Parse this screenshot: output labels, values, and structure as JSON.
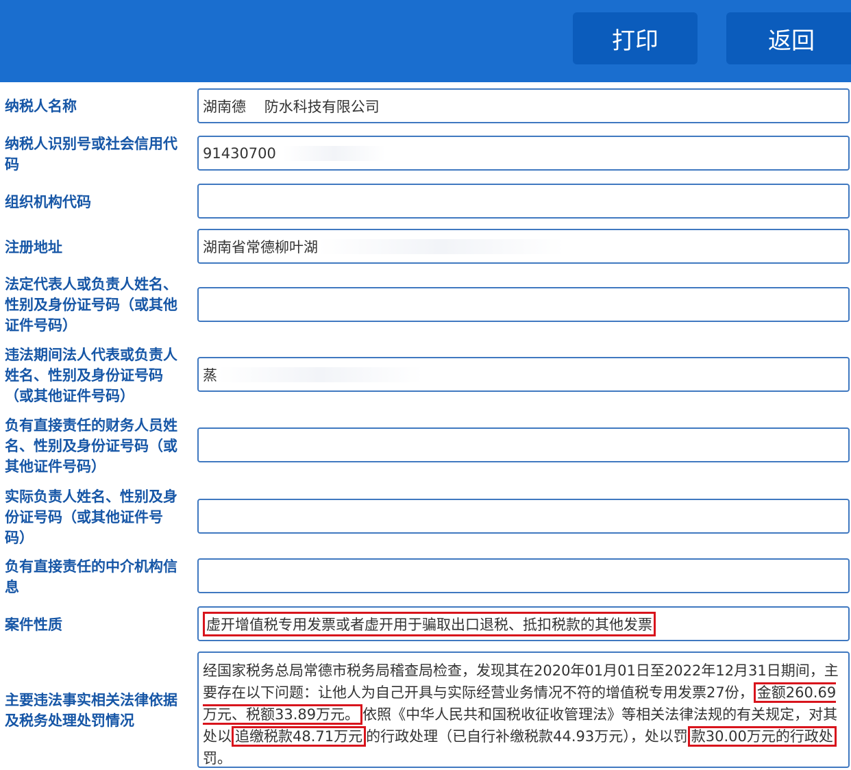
{
  "header": {
    "print_label": "打印",
    "back_label": "返回"
  },
  "fields": {
    "taxpayer_name": {
      "label": "纳税人名称",
      "value": "湖南德    防水科技有限公司"
    },
    "taxpayer_id": {
      "label": "纳税人识别号或社会信用代码",
      "value": "91430700"
    },
    "org_code": {
      "label": "组织机构代码",
      "value": ""
    },
    "reg_address": {
      "label": "注册地址",
      "value": "湖南省常德柳叶湖"
    },
    "legal_rep": {
      "label": "法定代表人或负责人姓名、性别及身份证号码（或其他证件号码）",
      "value": ""
    },
    "legal_rep_period": {
      "label": "违法期间法人代表或负责人姓名、性别及身份证号码（或其他证件号码）",
      "value": "蒸"
    },
    "finance_person": {
      "label": "负有直接责任的财务人员姓名、性别及身份证号码（或其他证件号码）",
      "value": ""
    },
    "actual_person": {
      "label": "实际负责人姓名、性别及身份证号码（或其他证件号码）",
      "value": ""
    },
    "agency_info": {
      "label": "负有直接责任的中介机构信息",
      "value": ""
    },
    "case_nature": {
      "label": "案件性质",
      "value": "虚开增值税专用发票或者虚开用于骗取出口退税、抵扣税款的其他发票"
    },
    "facts": {
      "label": "主要违法事实相关法律依据及税务处理处罚情况",
      "part1": "经国家税务总局常德市税务局稽查局检查，发现其在2020年01月01日至2022年12月31日期间，主要存在以下问题：让他人为自己开具与实际经营业务情况不符的增值税专用发票27份，",
      "hl1": "金额260.69万元、税额33.89万元。",
      "part2": "依照《中华人民共和国税收征收管理法》等相关法律法规的有关规定，对其处以",
      "hl2": "追缴税款48.71万元",
      "part3": "的行政处理（已自行补缴税款44.93万元），处以罚",
      "hl3": "款30.00万元的行政处",
      "part4": "罚。"
    }
  },
  "colors": {
    "topbar": "#1a6ecf",
    "button": "#0b5cbc",
    "label": "#1656a6",
    "field_border": "#3f78c0",
    "highlight": "#d8141c"
  }
}
